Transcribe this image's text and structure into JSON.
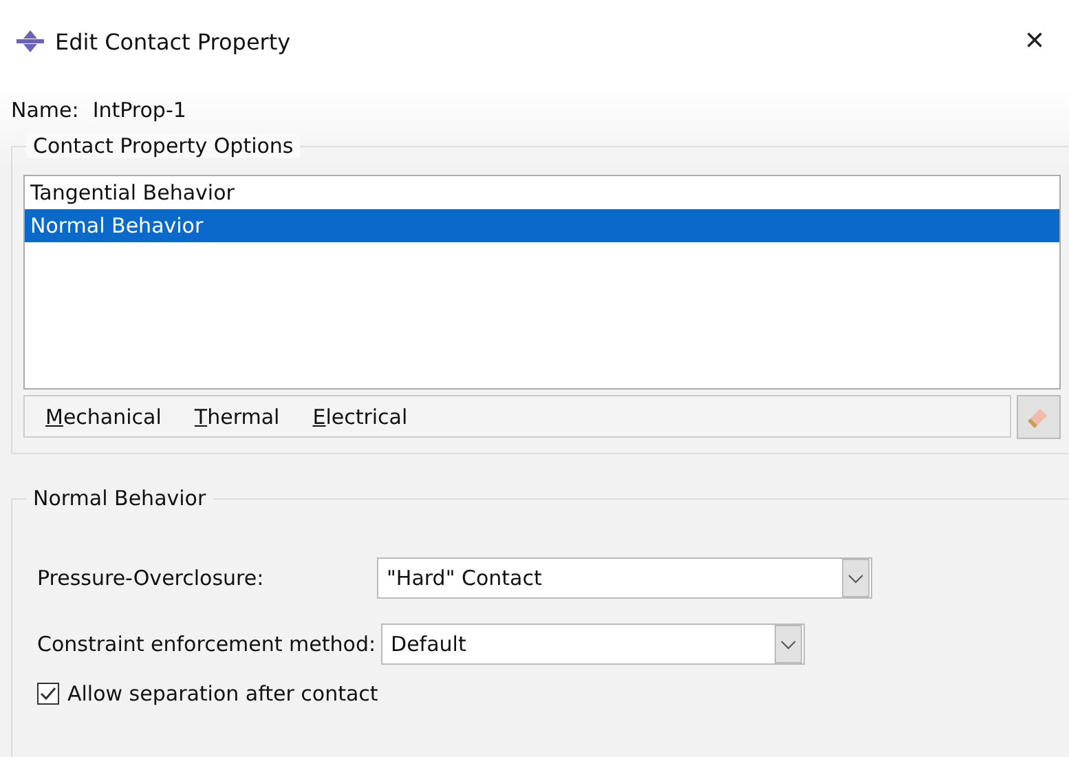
{
  "window": {
    "title": "Edit Contact Property",
    "close": "×"
  },
  "name": {
    "label": "Name:",
    "value": "IntProp-1"
  },
  "options_group": {
    "title": "Contact Property Options",
    "items": [
      {
        "label": "Tangential Behavior",
        "selected": false
      },
      {
        "label": "Normal Behavior",
        "selected": true
      }
    ],
    "menus": [
      "Mechanical",
      "Thermal",
      "Electrical"
    ]
  },
  "behavior_group": {
    "title": "Normal Behavior",
    "fields": [
      {
        "label": "Pressure-Overclosure:",
        "value": "\"Hard\" Contact"
      },
      {
        "label": "Constraint enforcement method:",
        "value": "Default"
      }
    ],
    "checkbox": {
      "label": "Allow separation after contact",
      "checked": true
    }
  }
}
